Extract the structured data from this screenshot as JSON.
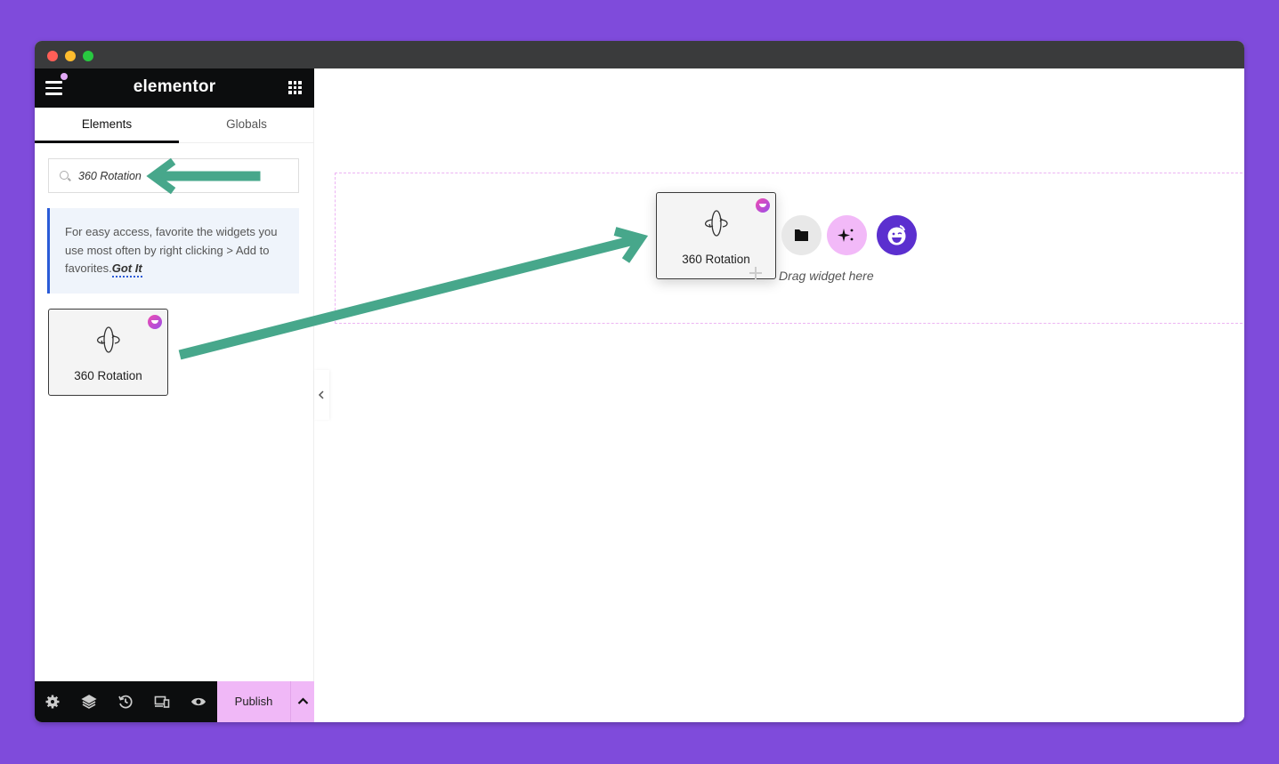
{
  "window": {
    "controls": [
      "close",
      "minimize",
      "maximize"
    ]
  },
  "panel": {
    "logo": "elementor",
    "tabs": [
      {
        "label": "Elements",
        "active": true
      },
      {
        "label": "Globals",
        "active": false
      }
    ],
    "search": {
      "value": "360 Rotation",
      "icon": "search-icon"
    },
    "tip": {
      "text": "For easy access, favorite the widgets you use most often by right clicking > Add to favorites.",
      "action": "Got It"
    },
    "widgets": [
      {
        "label": "360 Rotation",
        "icon": "rotate-360-icon",
        "badge": "plugin-badge-icon"
      }
    ],
    "bottom_bar": {
      "icons": [
        "settings-icon",
        "layers-icon",
        "history-icon",
        "responsive-icon",
        "preview-icon"
      ],
      "publish_label": "Publish"
    }
  },
  "canvas": {
    "dragged_widget": {
      "label": "360 Rotation"
    },
    "drop_hint": "Drag widget here",
    "actions": [
      "add-template-folder",
      "ai-assistant",
      "plugin-brand"
    ]
  },
  "annotations": {
    "arrow_color": "#47a78b",
    "accent_pink": "#f0b8f7",
    "brand_purple": "#5b2fcf",
    "background": "#7f4bdb"
  }
}
